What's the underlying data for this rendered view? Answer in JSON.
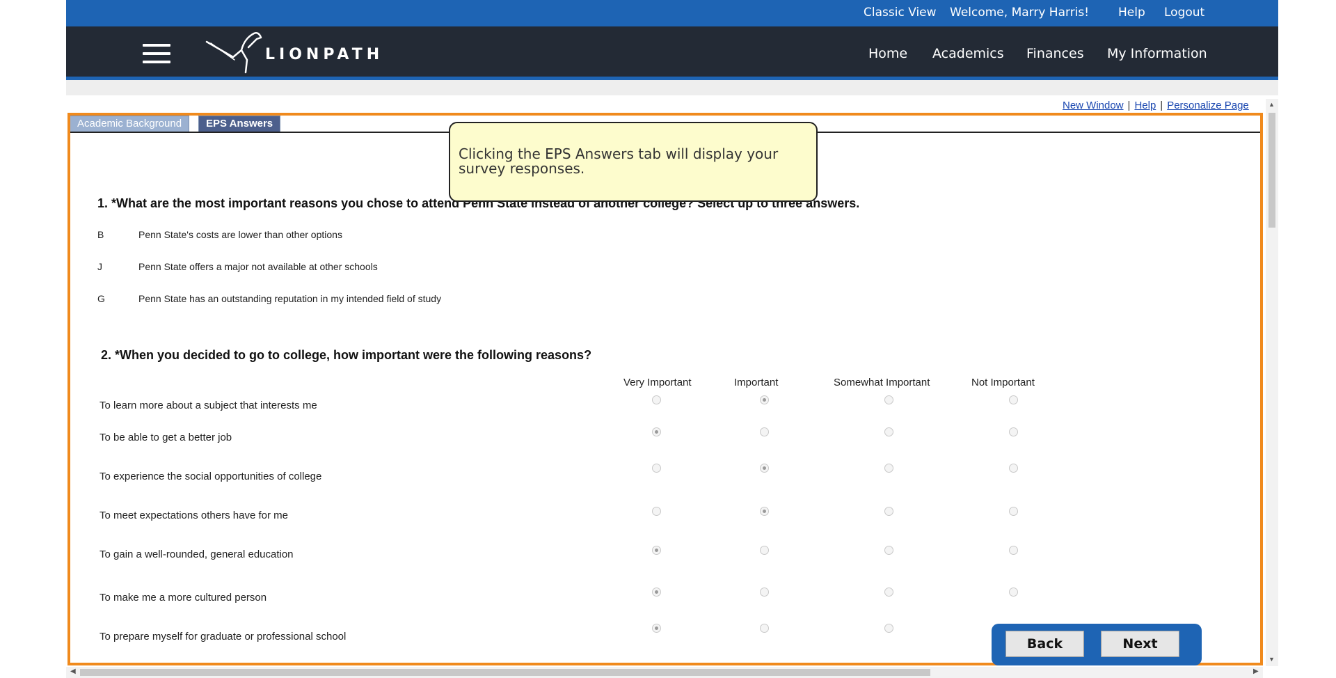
{
  "top_links": {
    "classic_view": "Classic View",
    "welcome": "Welcome,  Marry Harris!",
    "help": "Help",
    "logout": "Logout"
  },
  "brand": {
    "name": "LIONPATH"
  },
  "nav": {
    "home": "Home",
    "academics": "Academics",
    "finances": "Finances",
    "my_information": "My Information"
  },
  "page_links": {
    "new_window": "New Window",
    "help": "Help",
    "personalize": "Personalize Page",
    "separator": "|"
  },
  "tabs": {
    "academic_background": "Academic Background",
    "eps_answers": "EPS Answers"
  },
  "tooltip": {
    "text": "Clicking the EPS Answers tab will display your survey responses."
  },
  "question1": {
    "title": "1. *What are the most important reasons you chose to attend Penn State instead of another college? Select up to three answers.",
    "answers": [
      {
        "code": "B",
        "text": "Penn State's costs are lower than other options"
      },
      {
        "code": "J",
        "text": "Penn State offers a major not available at other schools"
      },
      {
        "code": "G",
        "text": "Penn State has an outstanding reputation in my intended field of study"
      }
    ]
  },
  "question2": {
    "title": "2. *When you decided to go to college, how important were the following reasons?",
    "columns": [
      "Very Important",
      "Important",
      "Somewhat Important",
      "Not Important"
    ],
    "rows": [
      {
        "label": "To learn more about a subject that interests me",
        "selected": "Important"
      },
      {
        "label": "To be able to get a better job",
        "selected": "Very Important"
      },
      {
        "label": "To experience the social opportunities of college",
        "selected": "Important"
      },
      {
        "label": "To meet expectations others have for me",
        "selected": "Important"
      },
      {
        "label": "To gain a well-rounded, general education",
        "selected": "Very Important"
      },
      {
        "label": "To make me a more cultured person",
        "selected": "Very Important"
      },
      {
        "label": "To prepare myself for graduate or professional school",
        "selected": "Very Important"
      }
    ]
  },
  "buttons": {
    "back": "Back",
    "next": "Next"
  },
  "colors": {
    "top_bar": "#1e64b4",
    "nav_bar": "#232a35",
    "highlight_border": "#f08a1d",
    "tooltip_bg": "#fdfccd"
  }
}
